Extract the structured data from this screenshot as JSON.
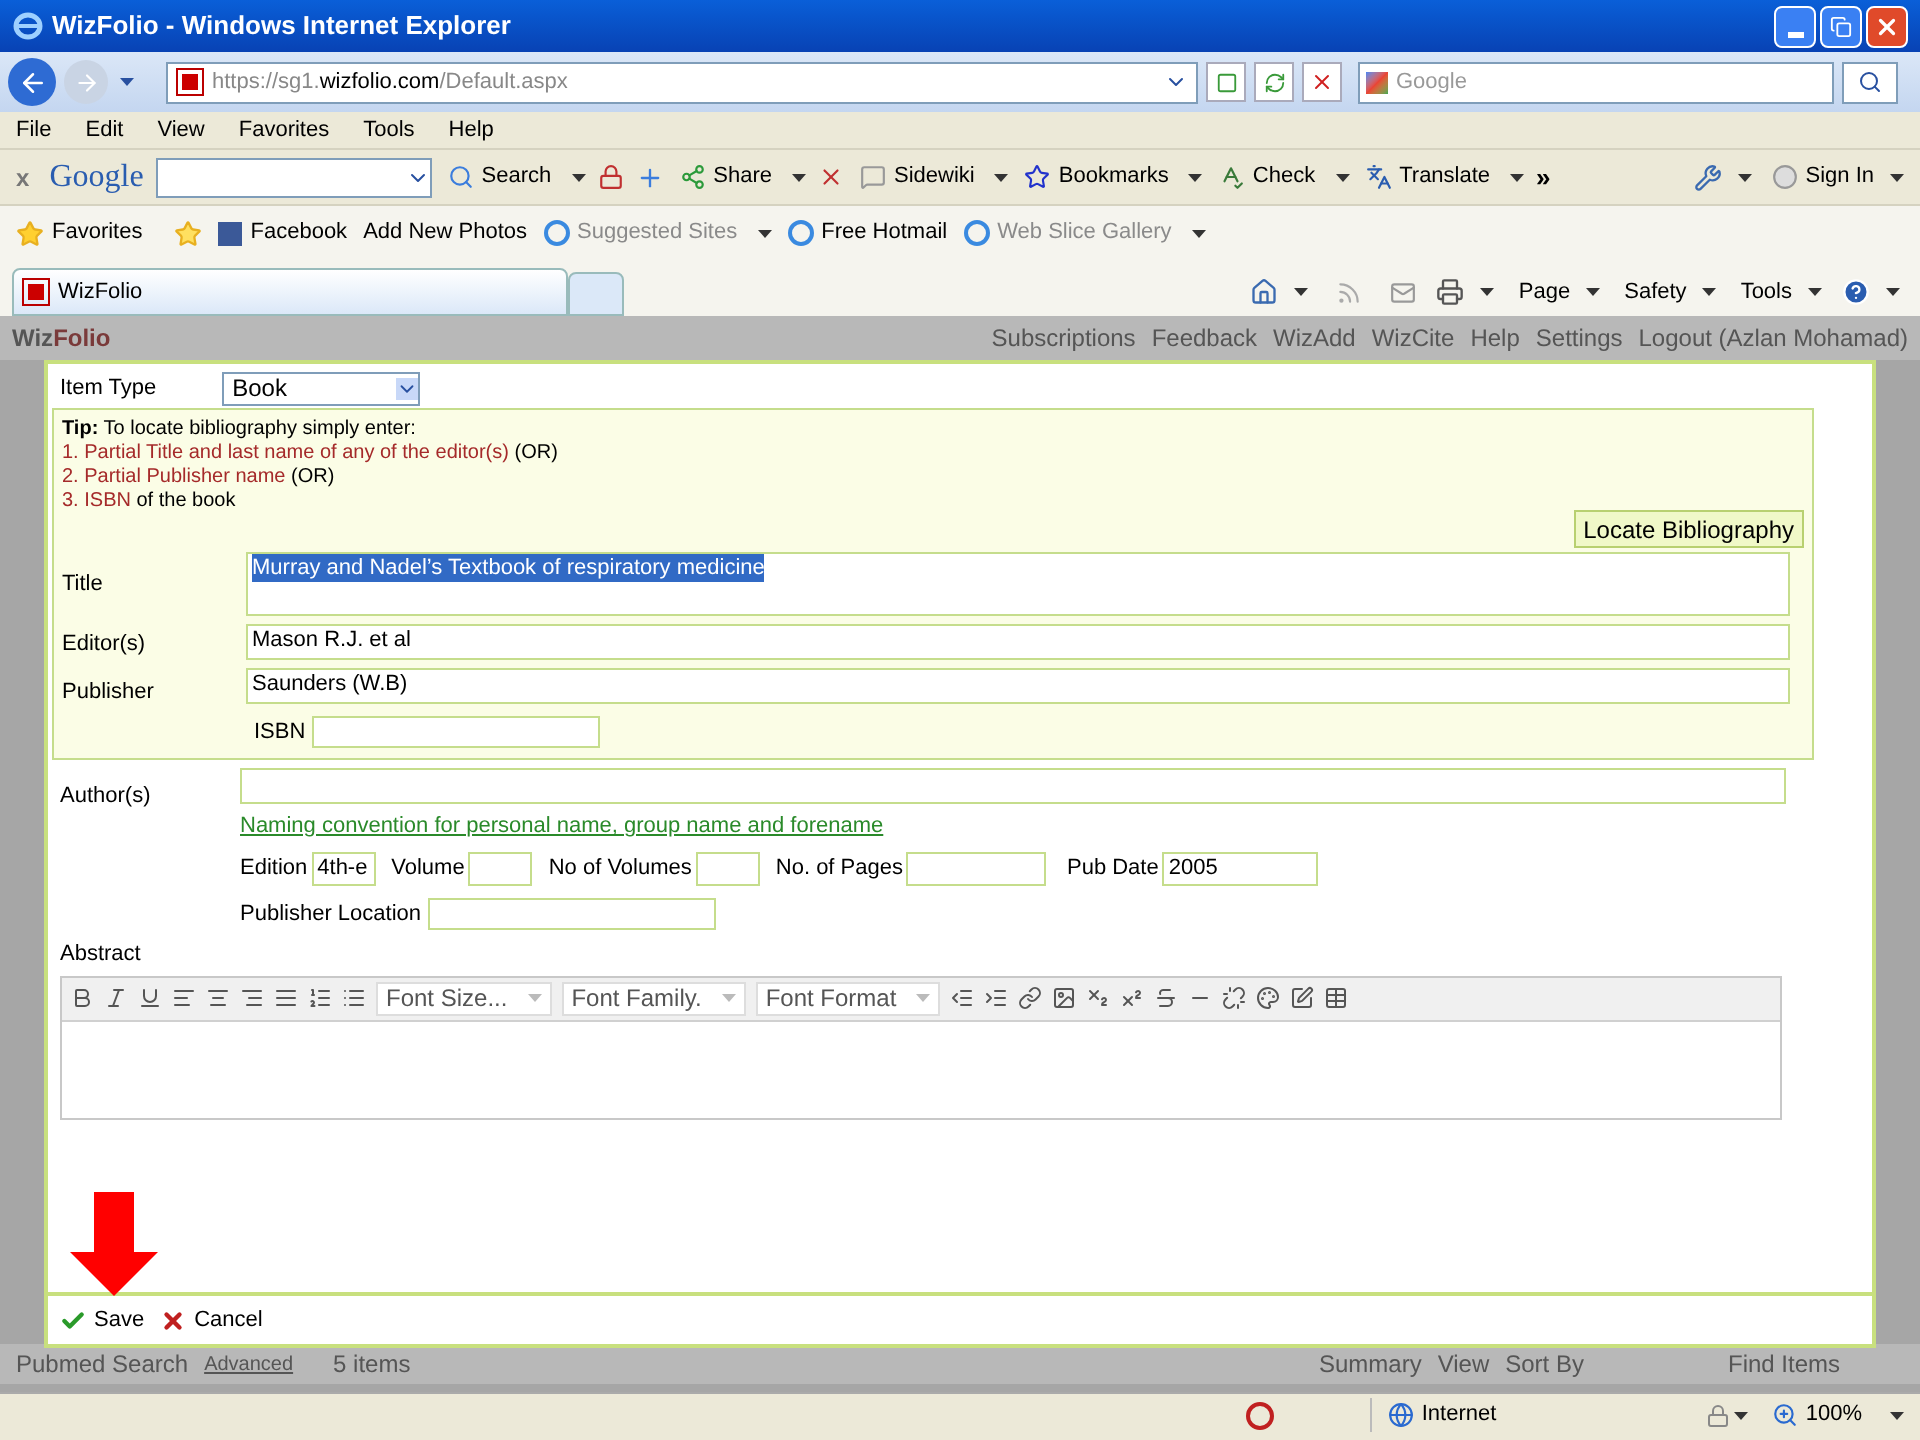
{
  "window": {
    "title": "WizFolio - Windows Internet Explorer"
  },
  "address_bar": {
    "url_prefix": "https://sg1.",
    "url_domain": "wizfolio.com",
    "url_path": "/Default.aspx",
    "search_placeholder": "Google"
  },
  "menu_bar": [
    "File",
    "Edit",
    "View",
    "Favorites",
    "Tools",
    "Help"
  ],
  "google_toolbar": {
    "close": "x",
    "logo": "Google",
    "buttons": [
      "Search",
      "Share",
      "Sidewiki",
      "Bookmarks",
      "Check",
      "Translate"
    ],
    "more": "»",
    "sign_in": "Sign In"
  },
  "favorites_bar": [
    {
      "label": "Favorites",
      "dimmed": false
    },
    {
      "label": "Facebook",
      "dimmed": false
    },
    {
      "label": "Add New Photos",
      "dimmed": false
    },
    {
      "label": "Suggested Sites",
      "dimmed": true
    },
    {
      "label": "Free Hotmail",
      "dimmed": false
    },
    {
      "label": "Web Slice Gallery",
      "dimmed": true
    }
  ],
  "tabs": [
    {
      "label": "WizFolio",
      "selected": true
    }
  ],
  "command_bar": [
    "Page",
    "Safety",
    "Tools"
  ],
  "background_page": {
    "logo_start": "Wiz",
    "logo_end": "Folio",
    "nav": [
      "Subscriptions",
      "Feedback",
      "WizAdd",
      "WizCite",
      "Help",
      "Settings",
      "Logout (Azlan Mohamad)"
    ],
    "bottom": {
      "search": "Pubmed Search",
      "advanced": "Advanced",
      "count": "5 items",
      "summary": "Summary",
      "view": "View",
      "sort": "Sort By",
      "find": "Find Items"
    }
  },
  "dialog": {
    "item_type": {
      "label": "Item Type",
      "value": "Book"
    },
    "tip": {
      "lead": "Tip:",
      "text": "To locate bibliography simply enter:",
      "lines": [
        {
          "highlight": "1. Partial Title and last name of any of the editor(s)",
          "rest": "(OR)"
        },
        {
          "highlight": "2. Partial Publisher name",
          "rest": "(OR)"
        },
        {
          "highlight": "3. ISBN",
          "rest": "of the book"
        }
      ]
    },
    "locate_button": "Locate Bibliography",
    "title": {
      "label": "Title",
      "value": "Murray and Nadel’s Textbook of respiratory medicine",
      "highlighted": true
    },
    "editors": {
      "label": "Editor(s)",
      "value": "Mason R.J. et al"
    },
    "publisher": {
      "label": "Publisher",
      "value": "Saunders (W.B)"
    },
    "isbn": {
      "label": "ISBN"
    },
    "authors": {
      "label": "Author(s)",
      "link": "Naming convention for personal name, group name and forename"
    },
    "details": [
      {
        "label": "Edition",
        "value": "4th-e"
      },
      {
        "label": "Volume"
      },
      {
        "label": "No of Volumes"
      },
      {
        "label": "No. of Pages"
      },
      {
        "label": "Pub Date",
        "value": "2005"
      }
    ],
    "publisher_location": {
      "label": "Publisher Location"
    },
    "abstract": {
      "label": "Abstract",
      "dropdowns": [
        "Font Size...",
        "Font Family.",
        "Font Format"
      ]
    },
    "save": "Save",
    "cancel": "Cancel"
  },
  "status_bar": {
    "zone": "Internet",
    "zoom": "100%"
  }
}
